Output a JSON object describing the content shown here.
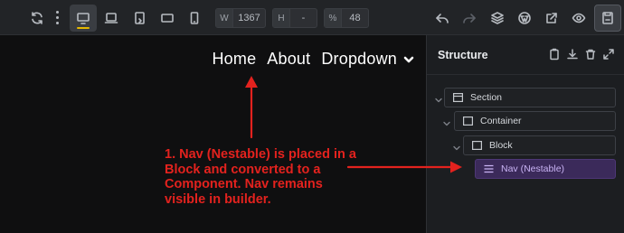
{
  "toolbar": {
    "width_label": "W",
    "width_value": "1367",
    "height_label": "H",
    "height_value": "-",
    "scale_label": "%",
    "scale_value": "48"
  },
  "canvas": {
    "nav_items": [
      "Home",
      "About",
      "Dropdown"
    ],
    "annotation": "1. Nav (Nestable) is placed in a Block and converted to a Component. Nav remains visible in builder.",
    "annotation_color": "#e3221e"
  },
  "structure": {
    "title": "Structure",
    "tree": [
      {
        "label": "Section",
        "icon": "section-icon"
      },
      {
        "label": "Container",
        "icon": "container-icon"
      },
      {
        "label": "Block",
        "icon": "block-icon"
      },
      {
        "label": "Nav (Nestable)",
        "icon": "nav-menu-icon",
        "selected": true
      }
    ],
    "selected_color": "#3b2a5a"
  },
  "colors": {
    "accent_underline": "#e6b800",
    "toolbar_bg": "#222427",
    "canvas_bg": "#0f0f10",
    "panel_bg": "#1c1e21"
  }
}
